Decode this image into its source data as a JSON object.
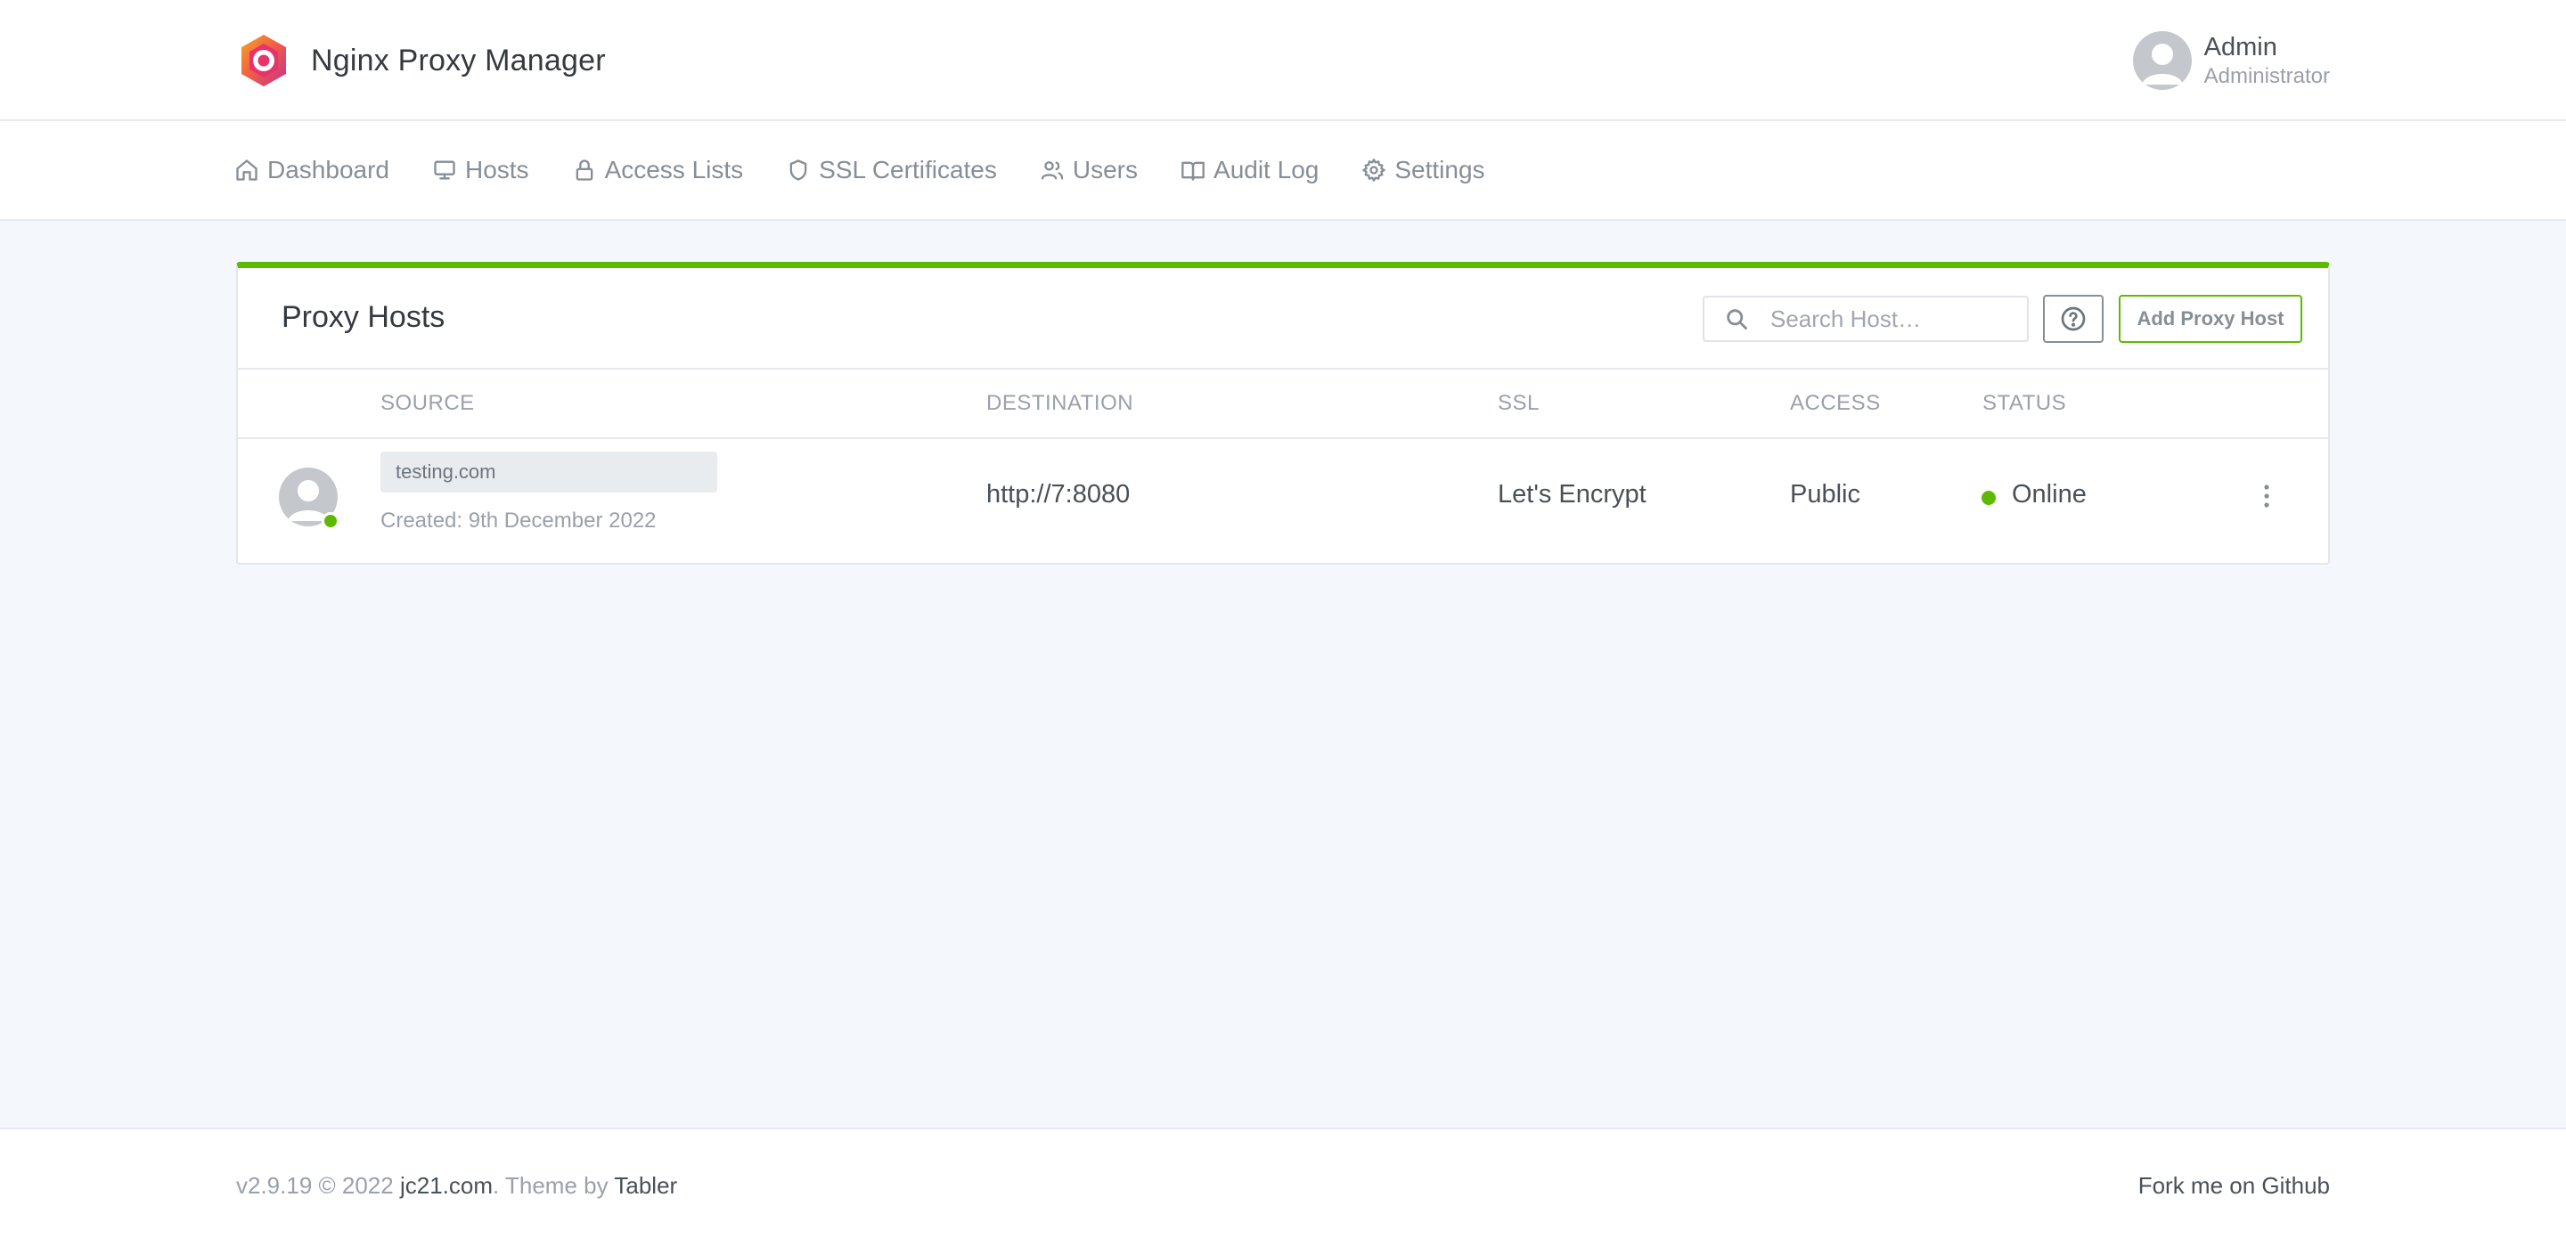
{
  "app": {
    "name": "Nginx Proxy Manager"
  },
  "user": {
    "name": "Admin",
    "role": "Administrator"
  },
  "nav": {
    "items": [
      {
        "label": "Dashboard",
        "icon": "home-icon"
      },
      {
        "label": "Hosts",
        "icon": "monitor-icon"
      },
      {
        "label": "Access Lists",
        "icon": "lock-icon"
      },
      {
        "label": "SSL Certificates",
        "icon": "shield-icon"
      },
      {
        "label": "Users",
        "icon": "users-icon"
      },
      {
        "label": "Audit Log",
        "icon": "book-open-icon"
      },
      {
        "label": "Settings",
        "icon": "settings-icon"
      }
    ]
  },
  "proxy_hosts": {
    "title": "Proxy Hosts",
    "search_placeholder": "Search Host…",
    "add_button_label": "Add Proxy Host",
    "columns": [
      "SOURCE",
      "DESTINATION",
      "SSL",
      "ACCESS",
      "STATUS"
    ],
    "rows": [
      {
        "source": "testing.com",
        "created": "Created: 9th December 2022",
        "destination": "http://7:8080",
        "ssl": "Let's Encrypt",
        "access": "Public",
        "status": "Online"
      }
    ]
  },
  "footer": {
    "version": "v2.9.19 © 2022",
    "author_link": "jc21.com",
    "theme_text": ". Theme by",
    "theme_link": "Tabler",
    "github_link": "Fork me on Github"
  },
  "colors": {
    "accent_green": "#5eba00",
    "page_background": "#f4f7fb",
    "muted_text": "#9aa0ac"
  }
}
